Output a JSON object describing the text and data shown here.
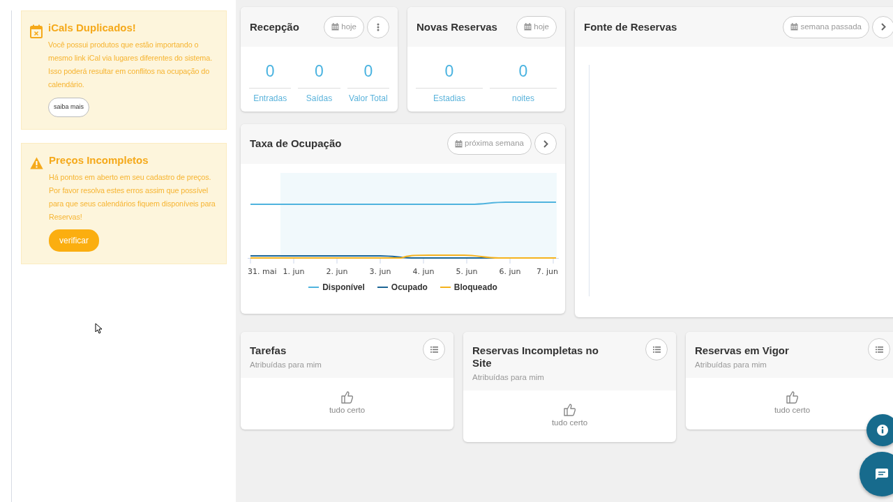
{
  "alerts": [
    {
      "kind": "calendar",
      "title": "iCals Duplicados!",
      "text": "Você possui produtos que estão importando o mesmo link iCal via lugares diferentes do sistema. Isso poderá resultar em conflitos na ocupação do calendário.",
      "button": "saiba mais"
    },
    {
      "kind": "warning",
      "title": "Preços Incompletos",
      "text": "Há pontos em aberto em seu cadastro de preços. Por favor resolva estes erros assim que possível para que seus calendários fiquem disponíveis para Reservas!",
      "button": "verificar"
    }
  ],
  "reception": {
    "title": "Recepção",
    "period": "hoje",
    "menu_button": true,
    "stats": [
      {
        "value": "0",
        "label": "Entradas"
      },
      {
        "value": "0",
        "label": "Saídas"
      },
      {
        "value": "0",
        "label": "Valor Total"
      }
    ]
  },
  "new_bookings": {
    "title": "Novas Reservas",
    "period": "hoje",
    "menu_button": false,
    "stats": [
      {
        "value": "0",
        "label": "Estadias"
      },
      {
        "value": "0",
        "label": "noites"
      }
    ]
  },
  "occupancy": {
    "title": "Taxa de Ocupação",
    "period": "próxima semana",
    "next_button": true,
    "x_labels": [
      "31. mai",
      "1. jun",
      "2. jun",
      "3. jun",
      "4. jun",
      "5. jun",
      "6. jun",
      "7. jun"
    ],
    "legend": [
      {
        "name": "Disponível",
        "color": "#4fb3de"
      },
      {
        "name": "Ocupado",
        "color": "#1b6595"
      },
      {
        "name": "Bloqueado",
        "color": "#f5b21c"
      }
    ]
  },
  "booking_sources": {
    "title": "Fonte de Reservas",
    "period": "semana passada",
    "next_button": true
  },
  "task_cards": [
    {
      "title": "Tarefas",
      "subtitle": "Atribuídas para mim",
      "empty_text": "tudo certo"
    },
    {
      "title": "Reservas Incompletas no Site",
      "subtitle": "Atribuídas para mim",
      "empty_text": "tudo certo"
    },
    {
      "title": "Reservas em Vigor",
      "subtitle": "Atribuídas para mim",
      "empty_text": "tudo certo"
    }
  ]
}
